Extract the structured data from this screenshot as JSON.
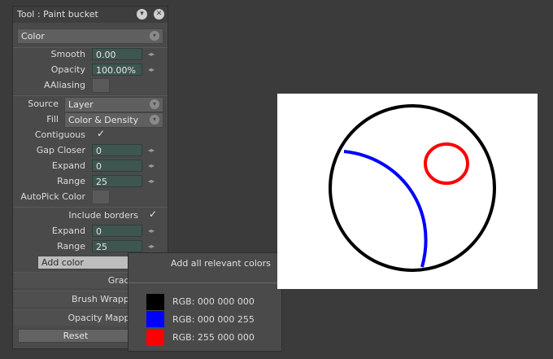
{
  "panel": {
    "title": "Tool : Paint bucket",
    "mode_combo": "Color",
    "smooth": {
      "label": "Smooth",
      "value": "0.00"
    },
    "opacity": {
      "label": "Opacity",
      "value": "100.00%"
    },
    "aaliasing": {
      "label": "AAliasing",
      "checked": false
    },
    "source": {
      "label": "Source",
      "value": "Layer"
    },
    "fill": {
      "label": "Fill",
      "value": "Color & Density"
    },
    "contiguous": {
      "label": "Contiguous",
      "checked": true
    },
    "gap_closer": {
      "label": "Gap Closer",
      "value": "0"
    },
    "expand1": {
      "label": "Expand",
      "value": "0"
    },
    "range1": {
      "label": "Range",
      "value": "25"
    },
    "autopick": {
      "label": "AutoPick Color",
      "checked": false
    },
    "include_borders": {
      "label": "Include borders",
      "checked": true
    },
    "expand2": {
      "label": "Expand",
      "value": "0"
    },
    "range2": {
      "label": "Range",
      "value": "25"
    },
    "add_color": "Add color",
    "sections": [
      "Gradie",
      "Brush Wrappi",
      "Opacity Mappi"
    ],
    "reset": "Reset"
  },
  "popup": {
    "header": "Add all relevant colors",
    "colors": [
      {
        "label": "RGB: 000 000 000",
        "hex": "#000000"
      },
      {
        "label": "RGB: 000 000 255",
        "hex": "#0000ff"
      },
      {
        "label": "RGB: 255 000 000",
        "hex": "#ff0000"
      }
    ]
  },
  "icons": {
    "collapse": "chevron-down-icon",
    "close": "close-icon",
    "check": "checkmark-icon",
    "spin": "spin-arrows-icon"
  }
}
